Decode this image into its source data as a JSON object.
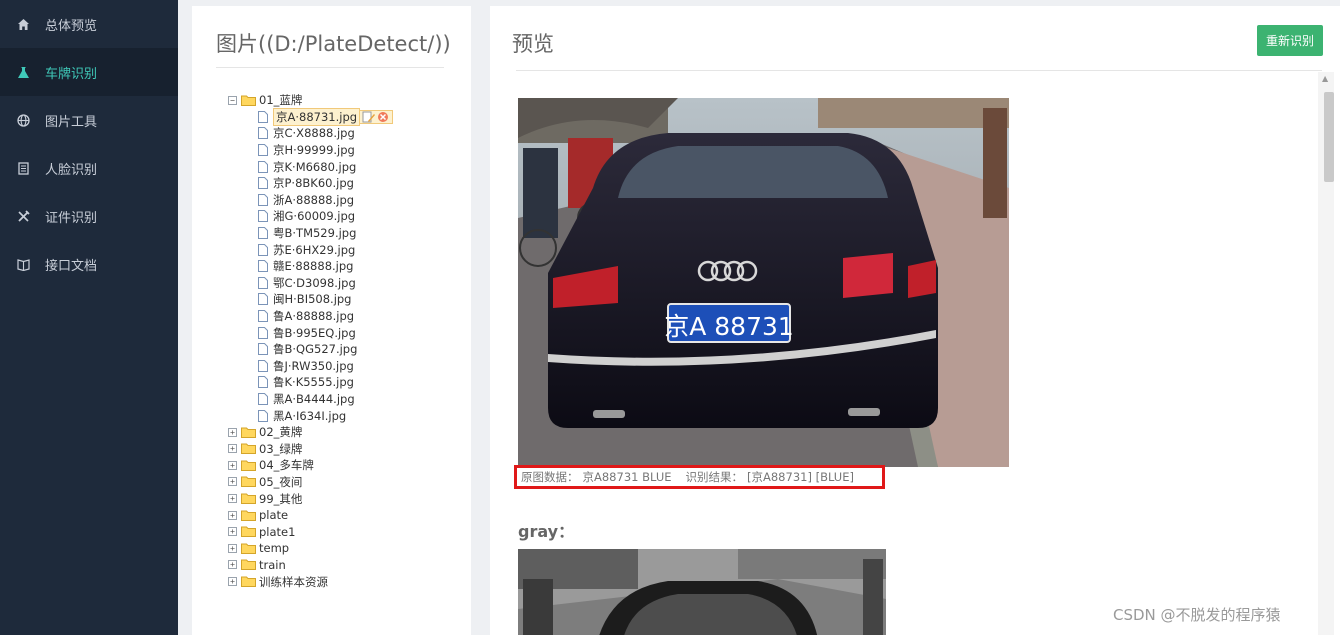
{
  "sidebar": {
    "items": [
      {
        "label": "总体预览",
        "icon": "home-icon",
        "active": false
      },
      {
        "label": "车牌识别",
        "icon": "flask-icon",
        "active": true
      },
      {
        "label": "图片工具",
        "icon": "globe-icon",
        "active": false
      },
      {
        "label": "人脸识别",
        "icon": "document-icon",
        "active": false
      },
      {
        "label": "证件识别",
        "icon": "tools-icon",
        "active": false
      },
      {
        "label": "接口文档",
        "icon": "book-icon",
        "active": false
      }
    ]
  },
  "file_panel": {
    "title": "图片((D:/PlateDetect/))",
    "tree": {
      "open_folder": "01_蓝牌",
      "files": [
        "京A·88731.jpg",
        "京C·X8888.jpg",
        "京H·99999.jpg",
        "京K·M6680.jpg",
        "京P·8BK60.jpg",
        "浙A·88888.jpg",
        "湘G·60009.jpg",
        "粤B·TM529.jpg",
        "苏E·6HX29.jpg",
        "赣E·88888.jpg",
        "鄂C·D3098.jpg",
        "闽H·BI508.jpg",
        "鲁A·88888.jpg",
        "鲁B·995EQ.jpg",
        "鲁B·QG527.jpg",
        "鲁J·RW350.jpg",
        "鲁K·K5555.jpg",
        "黑A·B4444.jpg",
        "黑A·I634I.jpg"
      ],
      "selected_file": "京A·88731.jpg",
      "collapsed_folders": [
        "02_黄牌",
        "03_绿牌",
        "04_多车牌",
        "05_夜间",
        "99_其他",
        "plate",
        "plate1",
        "temp",
        "train",
        "训练样本资源"
      ]
    }
  },
  "preview": {
    "title": "预览",
    "recognize_button": "重新识别",
    "result": {
      "source_label": "原图数据：",
      "source_value": "京A88731 BLUE",
      "result_label": "识别结果：",
      "result_value": "[京A88731] [BLUE]"
    },
    "plate_text": "京A 88731",
    "gray_label": "gray："
  },
  "watermark": "CSDN @不脱发的程序猿"
}
